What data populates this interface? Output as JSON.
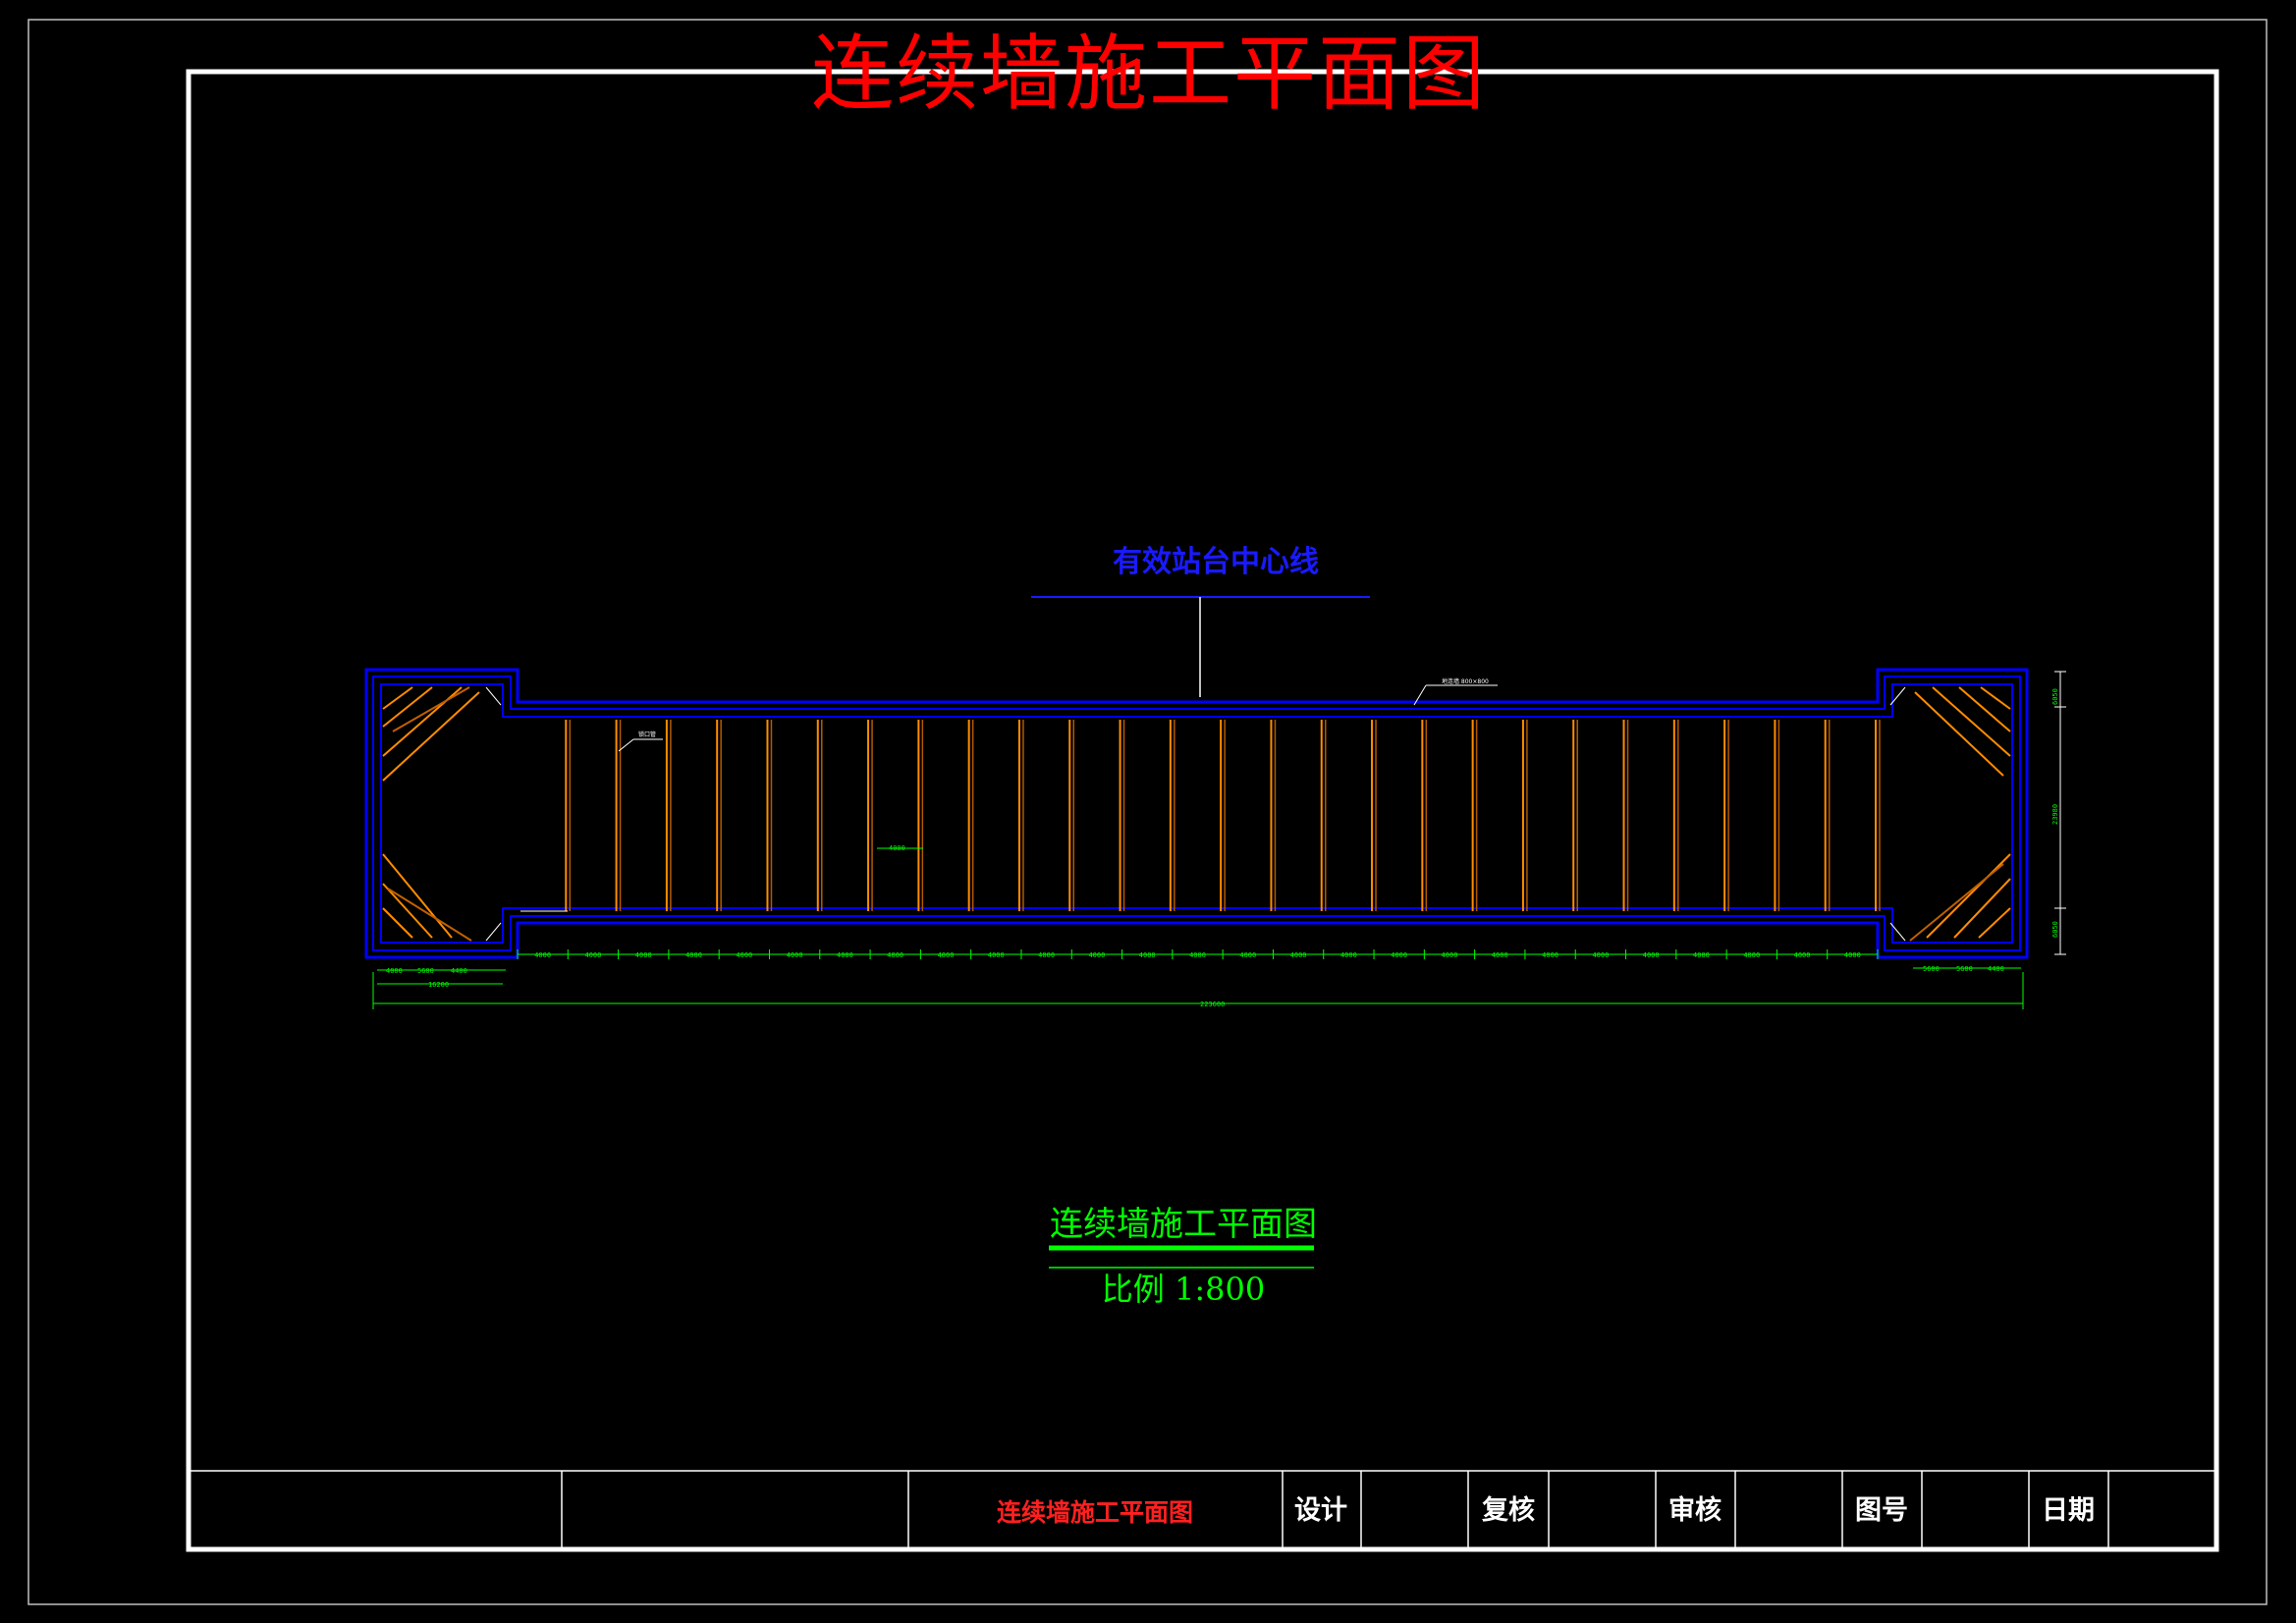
{
  "drawing": {
    "title": "连续墙施工平面图",
    "centerline_label": "有效站台中心线",
    "caption": "连续墙施工平面图",
    "scale": "比例 1:800",
    "colors": {
      "background": "#000000",
      "frame": "#ffffff",
      "title": "#ff0000",
      "wall": "#0000ff",
      "panel": "#ff8c00",
      "dimension": "#00ff00"
    }
  },
  "annotations": {
    "wall_note": "地连墙 800×800",
    "tie_note": "锁口管",
    "middle_span": "4000",
    "bay_dims": [
      "4000",
      "4000",
      "4000",
      "4000",
      "4000",
      "4000",
      "4000",
      "4000",
      "4000",
      "4000",
      "4000",
      "4000",
      "4000",
      "4000",
      "4000",
      "4000",
      "4000",
      "4000",
      "4000",
      "4000",
      "4000",
      "4000",
      "4000",
      "4000",
      "4000",
      "4000",
      "4000"
    ],
    "left_end_dims": [
      "4000",
      "5600",
      "4400"
    ],
    "left_end_total": "16200",
    "right_end_dims": [
      "5600",
      "5600",
      "4400"
    ],
    "overall_length": "223600",
    "right_dims": [
      "6050",
      "23980",
      "6050"
    ]
  },
  "title_block": {
    "drawing_name": "连续墙施工平面图",
    "design_label": "设计",
    "check_label": "复核",
    "review_label": "审核",
    "drawing_no_label": "图号",
    "date_label": "日期"
  }
}
